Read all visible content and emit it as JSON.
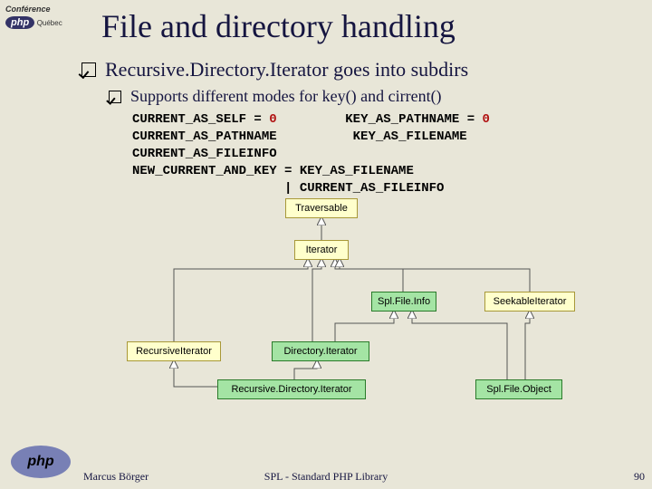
{
  "logo": {
    "conference_line1": "Conférence",
    "php_text": "php",
    "region": "Québec"
  },
  "title": "File and directory handling",
  "bullet1": "Recursive.Directory.Iterator goes into subdirs",
  "bullet2": "Supports different modes for key() and cirrent()",
  "constants": {
    "c1a": "CURRENT_AS_SELF ",
    "c1b": "= ",
    "c1z": "0",
    "c2": "CURRENT_AS_PATHNAME",
    "c3": "CURRENT_AS_FILEINFO",
    "c4a": "NEW_CURRENT_AND_KEY = KEY_AS_FILENAME",
    "c4b": "                    | CURRENT_AS_FILEINFO",
    "k1a": "KEY_AS_PATHNAME ",
    "k1b": "= ",
    "k1z": "0",
    "k2": "KEY_AS_FILENAME"
  },
  "diagram": {
    "traversable": "Traversable",
    "iterator": "Iterator",
    "splfileinfo": "Spl.File.Info",
    "seekable": "SeekableIterator",
    "recursiveit": "RecursiveIterator",
    "diriterator": "Directory.Iterator",
    "recdiriterator": "Recursive.Directory.Iterator",
    "splfileobject": "Spl.File.Object"
  },
  "footer": {
    "author": "Marcus Börger",
    "center": "SPL - Standard PHP Library",
    "page": "90"
  },
  "chart_data": {
    "type": "table",
    "title": "Class hierarchy (UML-style)",
    "nodes": [
      {
        "name": "Traversable",
        "kind": "interface"
      },
      {
        "name": "Iterator",
        "kind": "interface"
      },
      {
        "name": "SplFileInfo",
        "kind": "class"
      },
      {
        "name": "SeekableIterator",
        "kind": "interface"
      },
      {
        "name": "RecursiveIterator",
        "kind": "interface"
      },
      {
        "name": "DirectoryIterator",
        "kind": "class"
      },
      {
        "name": "RecursiveDirectoryIterator",
        "kind": "class"
      },
      {
        "name": "SplFileObject",
        "kind": "class"
      }
    ],
    "edges": [
      {
        "from": "Iterator",
        "to": "Traversable"
      },
      {
        "from": "SplFileInfo",
        "to": "Iterator"
      },
      {
        "from": "SeekableIterator",
        "to": "Iterator"
      },
      {
        "from": "RecursiveIterator",
        "to": "Iterator"
      },
      {
        "from": "DirectoryIterator",
        "to": "Iterator"
      },
      {
        "from": "DirectoryIterator",
        "to": "SplFileInfo"
      },
      {
        "from": "RecursiveDirectoryIterator",
        "to": "RecursiveIterator"
      },
      {
        "from": "RecursiveDirectoryIterator",
        "to": "DirectoryIterator"
      },
      {
        "from": "SplFileObject",
        "to": "SeekableIterator"
      },
      {
        "from": "SplFileObject",
        "to": "SplFileInfo"
      }
    ]
  }
}
